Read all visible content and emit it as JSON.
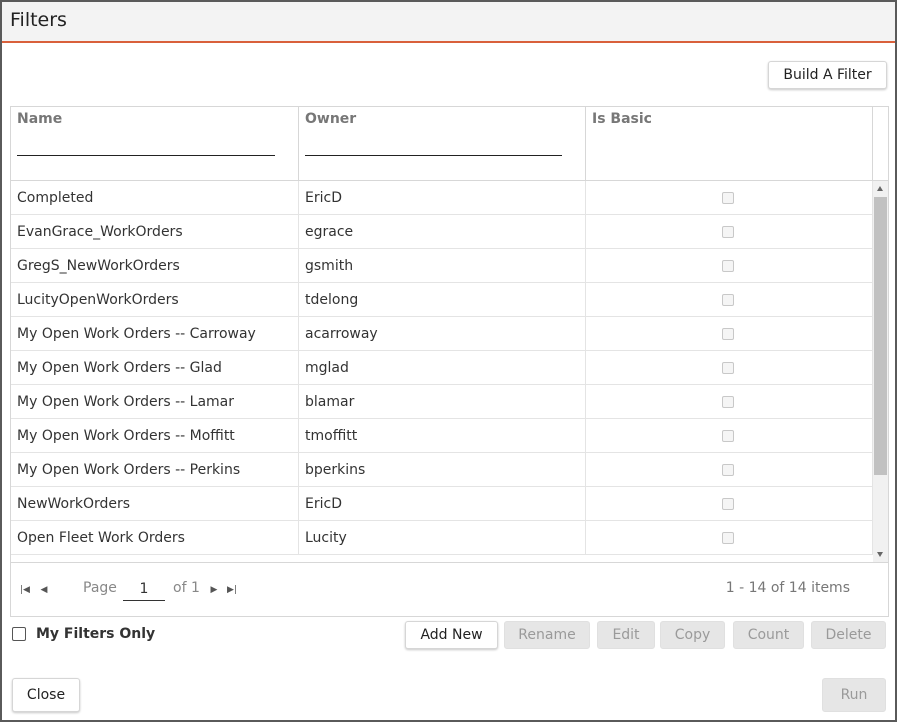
{
  "dialog": {
    "title": "Filters"
  },
  "toolbar": {
    "build_filter_label": "Build A Filter"
  },
  "grid": {
    "columns": [
      {
        "label": "Name"
      },
      {
        "label": "Owner"
      },
      {
        "label": "Is Basic"
      }
    ],
    "rows": [
      {
        "name": "Completed",
        "owner": "EricD",
        "is_basic": false
      },
      {
        "name": "EvanGrace_WorkOrders",
        "owner": "egrace",
        "is_basic": false
      },
      {
        "name": "GregS_NewWorkOrders",
        "owner": "gsmith",
        "is_basic": false
      },
      {
        "name": "LucityOpenWorkOrders",
        "owner": "tdelong",
        "is_basic": false
      },
      {
        "name": "My Open Work Orders -- Carroway",
        "owner": "acarroway",
        "is_basic": false
      },
      {
        "name": "My Open Work Orders -- Glad",
        "owner": "mglad",
        "is_basic": false
      },
      {
        "name": "My Open Work Orders -- Lamar",
        "owner": "blamar",
        "is_basic": false
      },
      {
        "name": "My Open Work Orders -- Moffitt",
        "owner": "tmoffitt",
        "is_basic": false
      },
      {
        "name": "My Open Work Orders -- Perkins",
        "owner": "bperkins",
        "is_basic": false
      },
      {
        "name": "NewWorkOrders",
        "owner": "EricD",
        "is_basic": false
      },
      {
        "name": "Open Fleet Work Orders",
        "owner": "Lucity",
        "is_basic": false
      }
    ]
  },
  "pager": {
    "page_label": "Page",
    "page_value": "1",
    "of_label": "of 1",
    "info": "1 - 14 of 14 items"
  },
  "my_filters_only": {
    "label": "My Filters Only",
    "checked": false
  },
  "actions": {
    "add_new": "Add New",
    "rename": "Rename",
    "edit": "Edit",
    "copy": "Copy",
    "count": "Count",
    "delete": "Delete"
  },
  "footer": {
    "close": "Close",
    "run": "Run"
  }
}
